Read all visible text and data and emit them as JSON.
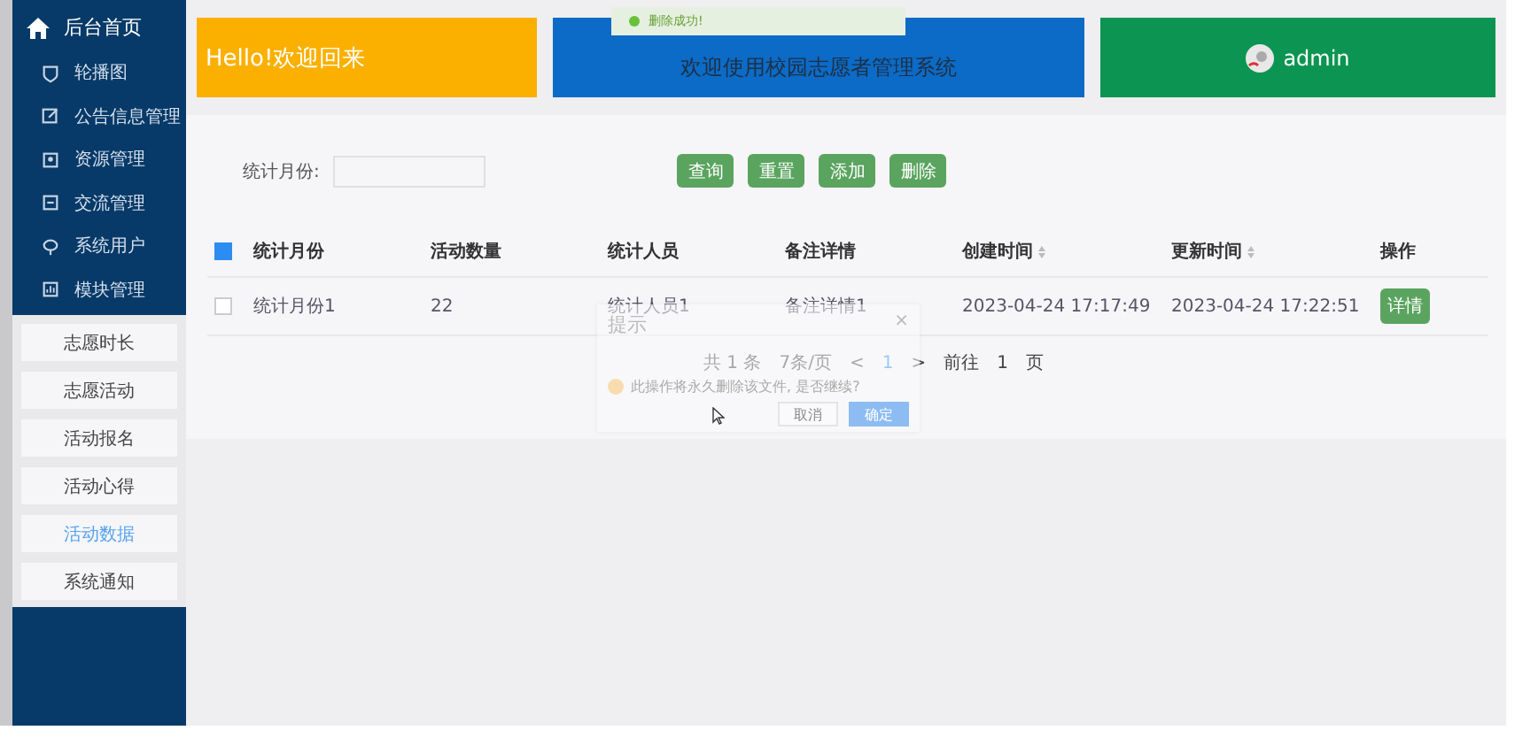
{
  "sidebar": {
    "title": "后台首页",
    "items": [
      {
        "label": "轮播图"
      },
      {
        "label": "公告信息管理"
      },
      {
        "label": "资源管理"
      },
      {
        "label": "交流管理"
      },
      {
        "label": "系统用户"
      },
      {
        "label": "模块管理"
      }
    ],
    "submenu": [
      {
        "label": "志愿时长",
        "selected": false
      },
      {
        "label": "志愿活动",
        "selected": false
      },
      {
        "label": "活动报名",
        "selected": false
      },
      {
        "label": "活动心得",
        "selected": false
      },
      {
        "label": "活动数据",
        "selected": true
      },
      {
        "label": "系统通知",
        "selected": false
      }
    ]
  },
  "cards": [
    {
      "kind": "greeting",
      "text": "Hello!欢迎回来"
    },
    {
      "kind": "banner",
      "text": "欢迎使用校园志愿者管理系统"
    },
    {
      "kind": "user",
      "text": "admin"
    }
  ],
  "toasts": [
    {
      "text": "删除成功!"
    }
  ],
  "search": {
    "label": "统计月份:"
  },
  "buttons": [
    "查询",
    "重置",
    "添加",
    "删除"
  ],
  "table": {
    "all_checked": true,
    "columns": [
      {
        "label": "统计月份",
        "sortable": false
      },
      {
        "label": "活动数量",
        "sortable": false
      },
      {
        "label": "统计人员",
        "sortable": false
      },
      {
        "label": "备注详情",
        "sortable": false
      },
      {
        "label": "创建时间",
        "sortable": true
      },
      {
        "label": "更新时间",
        "sortable": true
      },
      {
        "label": "操作",
        "sortable": false
      }
    ],
    "rows": [
      {
        "checked": false,
        "cells": [
          "统计月份1",
          "22",
          "统计人员1",
          "备注详情1",
          "2023-04-24 17:17:49",
          "2023-04-24 17:22:51"
        ],
        "action": "详情"
      }
    ]
  },
  "pagination": {
    "total": "共 1 条",
    "page_size": "7条/页",
    "prev": "<",
    "page": "1",
    "next": ">",
    "goto": "前往",
    "goto_value": "1",
    "suffix": "页"
  },
  "dialog": {
    "title": "提示",
    "close": "×",
    "message": "此操作将永久删除该文件, 是否继续?",
    "buttons": [
      "取消",
      "确定"
    ]
  }
}
